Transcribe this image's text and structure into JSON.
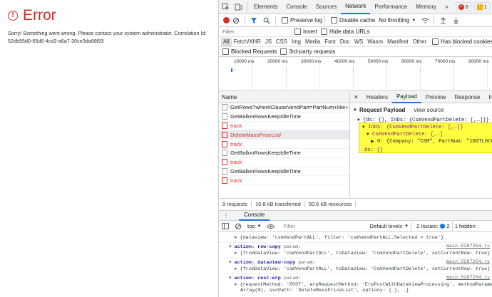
{
  "app": {
    "error_title": "Error",
    "error_message": "Sorry! Something went wrong. Please contact your system administrator. Correlation Id: 52db95d0-65d6-4cd3-a6a7-30ce3da66f93"
  },
  "devtools": {
    "tabs": [
      "Elements",
      "Console",
      "Sources",
      "Network",
      "Performance",
      "Memory"
    ],
    "active_tab": "Network",
    "more_tabs": "»",
    "errors_count": "6",
    "warnings_count": "1",
    "toolbar": {
      "preserve_log": "Preserve log",
      "disable_cache": "Disable cache",
      "throttling": "No throttling"
    },
    "filter": {
      "placeholder": "Filter",
      "invert": "Invert",
      "hide_data_urls": "Hide data URLs"
    },
    "types": [
      "All",
      "Fetch/XHR",
      "JS",
      "CSS",
      "Img",
      "Media",
      "Font",
      "Doc",
      "WS",
      "Wasm",
      "Manifest",
      "Other"
    ],
    "has_blocked_cookies": "Has blocked cookies",
    "blocked_requests": "Blocked Requests",
    "third_party_requests": "3rd-party requests",
    "timeline_ticks": [
      "10000 ms",
      "20000 ms",
      "30000 ms",
      "40000 ms",
      "50000 ms",
      "60000 ms",
      "70000 ms",
      "80000 ms"
    ],
    "name_header": "Name",
    "requests": [
      {
        "name": "GetRows?whereClauseVendPart=PartNum+like+...",
        "status": "ok"
      },
      {
        "name": "GetBallonRowsKeepIdleTime",
        "status": "ok"
      },
      {
        "name": "track",
        "status": "error"
      },
      {
        "name": "DeleteMassPriceList/",
        "status": "error"
      },
      {
        "name": "track",
        "status": "error"
      },
      {
        "name": "GetBallonRowsKeepIdleTime",
        "status": "ok"
      },
      {
        "name": "track",
        "status": "error"
      },
      {
        "name": "GetBallonRowsKeepIdleTime",
        "status": "ok"
      },
      {
        "name": "track",
        "status": "error"
      }
    ],
    "status_bar": {
      "requests": "9 requests",
      "transferred": "10.8 kB transferred",
      "resources": "50.6 kB resources"
    },
    "detail_tabs": [
      "Headers",
      "Payload",
      "Preview",
      "Response",
      "Initiator"
    ],
    "detail_active": "Payload",
    "payload": {
      "section_title": "Request Payload",
      "view_source": "view source",
      "summary": "{ds: {}, InDs: {CsmVendPartDelete: [,…]}}",
      "line_inds": "InDs: {CsmVendPartDelete: [,…]}",
      "line_csm": "CsmVendPartDelete: [,…]",
      "line_item": "0: {Company: \"CSM\", PartNum: \"10GTL6CG\", …}",
      "line_ds": "ds: {}"
    },
    "console": {
      "tab_label": "Console",
      "context": "top",
      "filter_placeholder": "Filter",
      "levels": "Default levels",
      "issues": "2 Issues:",
      "issues_count": "2",
      "hidden": "1 hidden",
      "logs": [
        {
          "action": "",
          "param": "",
          "detail": "{dataview: 'csmVendPartALL', filter: 'csmVendPartALL.Selected = true'}",
          "source": ""
        },
        {
          "action": "action: row-copy",
          "param": "param:",
          "detail": "{fromDataView: 'csmVendPartALL', toDataView: 'CsmVendPartDelete', setCurrentRow: true}",
          "source": "main.5287254…js"
        },
        {
          "action": "action: dataview-copy",
          "param": "param:",
          "detail": "{fromDataView: 'csmVendPartALL', toDataView: 'CsmVendPartDelete', setCurrentRow: true}",
          "source": "main.5287254…js"
        },
        {
          "action": "action: rest-erp",
          "param": "param:",
          "detail": "{requestMethod: 'POST', erpRequestMethod: 'ErpPostWithDataViewProcessing', methodParameters:",
          "detail2": "Array(0), svcPath: 'DeleteMassPriceList', options: {…}, …}",
          "source": "main.5287254…js"
        }
      ]
    }
  }
}
